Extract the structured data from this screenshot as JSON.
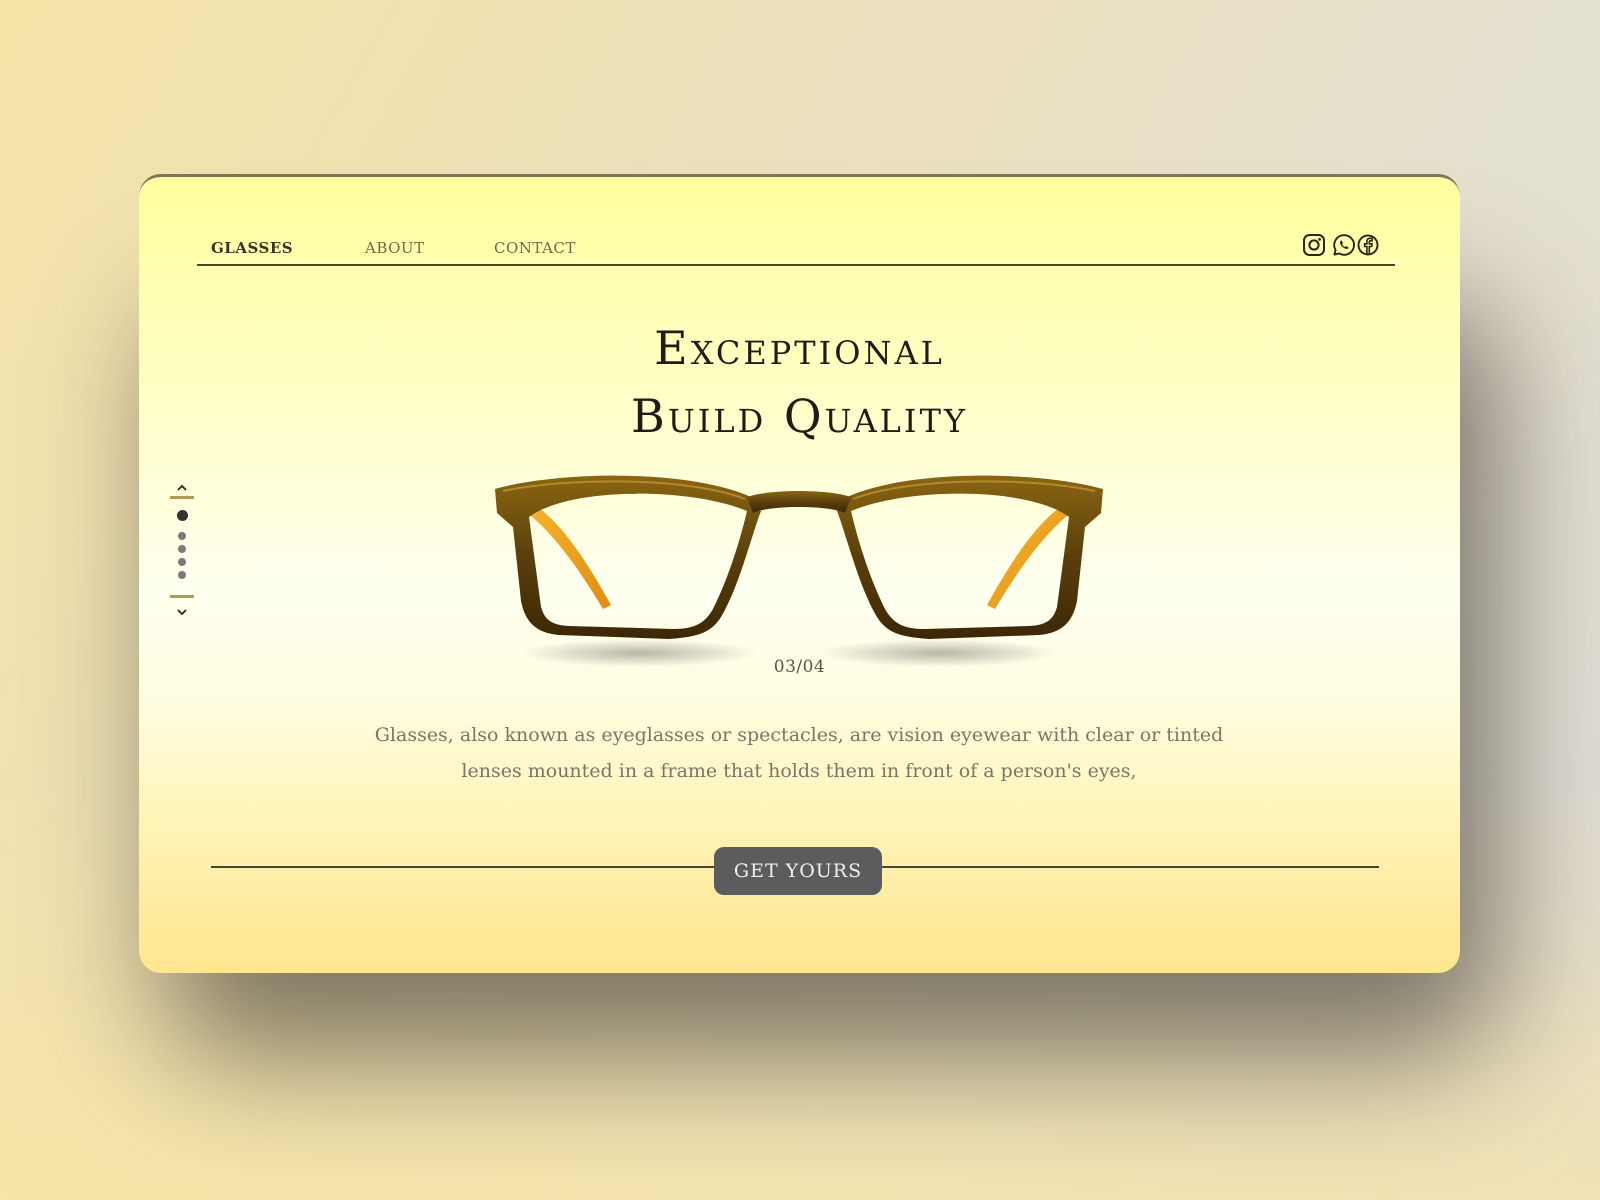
{
  "nav": {
    "items": [
      {
        "label": "GLASSES",
        "active": true
      },
      {
        "label": "ABOUT",
        "active": false
      },
      {
        "label": "CONTACT",
        "active": false
      }
    ],
    "social": [
      "instagram-icon",
      "whatsapp-icon",
      "facebook-icon"
    ]
  },
  "hero": {
    "headline_line1": "Exceptional",
    "headline_line2": "Build Quality",
    "counter": "03/04",
    "description": "Glasses, also known as eyeglasses or spectacles, are vision eyewear with clear or tinted lenses mounted in a frame that holds them in front of a person's eyes,",
    "cta_label": "GET YOURS"
  },
  "slider": {
    "total_dots": 5,
    "active_index": 0
  },
  "colors": {
    "card_top": "#ffff9e",
    "card_bottom": "#ffe690",
    "frame": "#6b4c10",
    "temple": "#f3a92a",
    "button": "#5b5c5e"
  }
}
